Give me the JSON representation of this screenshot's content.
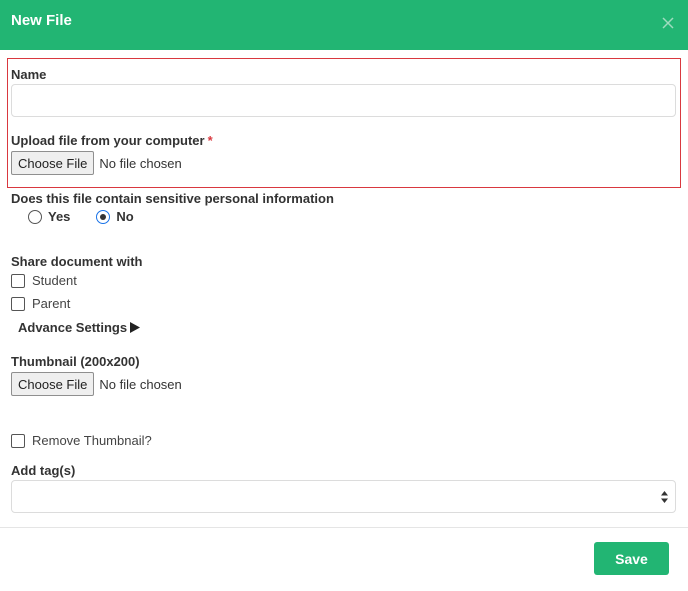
{
  "header": {
    "title": "New File",
    "close_icon": "close-icon"
  },
  "form": {
    "name": {
      "label": "Name",
      "value": "",
      "placeholder": ""
    },
    "upload": {
      "label": "Upload file from your computer",
      "required_mark": "*",
      "button_label": "Choose File",
      "status": "No file chosen"
    },
    "sensitive": {
      "label": "Does this file contain sensitive personal information",
      "options": [
        "Yes",
        "No"
      ],
      "selected": "No"
    },
    "share": {
      "label": "Share document with",
      "options": [
        {
          "label": "Student",
          "checked": false
        },
        {
          "label": "Parent",
          "checked": false
        }
      ]
    },
    "advance_settings": {
      "label": "Advance Settings",
      "icon": "play-icon"
    },
    "thumbnail": {
      "label": "Thumbnail (200x200)",
      "button_label": "Choose File",
      "status": "No file chosen"
    },
    "remove_thumbnail": {
      "label": "Remove Thumbnail?",
      "checked": false
    },
    "tags": {
      "label": "Add tag(s)",
      "value": ""
    }
  },
  "footer": {
    "save_label": "Save"
  },
  "colors": {
    "accent": "#22b573",
    "required": "#d9383f",
    "highlight_border": "#d9383f"
  }
}
